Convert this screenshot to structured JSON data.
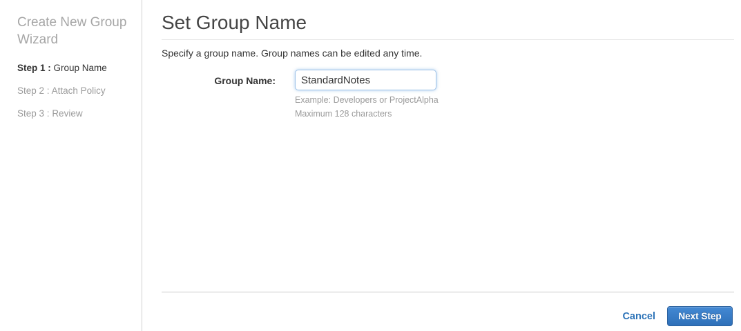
{
  "sidebar": {
    "title": "Create New Group Wizard",
    "steps": [
      {
        "prefix": "Step 1 :",
        "label": "Group Name",
        "active": true
      },
      {
        "prefix": "Step 2 :",
        "label": "Attach Policy",
        "active": false
      },
      {
        "prefix": "Step 3 :",
        "label": "Review",
        "active": false
      }
    ]
  },
  "main": {
    "title": "Set Group Name",
    "description": "Specify a group name. Group names can be edited any time.",
    "form": {
      "group_name_label": "Group Name:",
      "group_name_value": "StandardNotes",
      "hint_example": "Example: Developers or ProjectAlpha",
      "hint_max": "Maximum 128 characters"
    },
    "footer": {
      "cancel_label": "Cancel",
      "next_label": "Next Step"
    }
  },
  "colors": {
    "accent_blue": "#2c73b8",
    "button_gradient_top": "#4489d4",
    "button_gradient_bottom": "#2e70b9",
    "input_focus_border": "#9fc3e8",
    "muted_text": "#9a9a9a",
    "heading_text": "#444444",
    "divider": "#c9c9c9"
  }
}
